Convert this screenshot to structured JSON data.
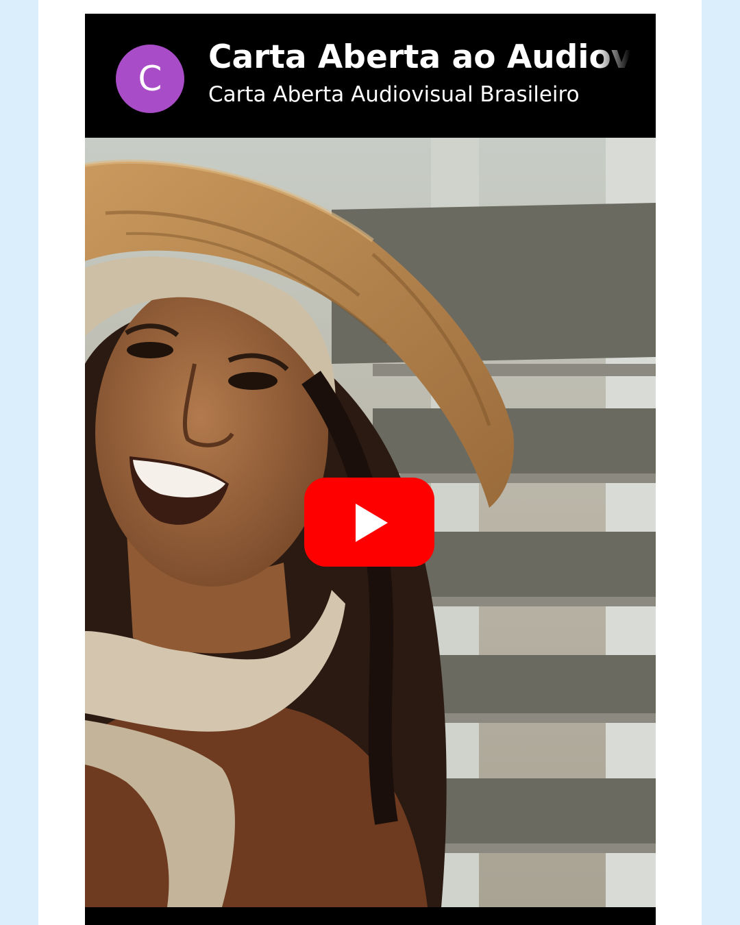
{
  "video": {
    "title": "Carta Aberta ao Audiovisual Brasileiro",
    "channel_name": "Carta Aberta Audiovisual Brasileiro",
    "avatar_letter": "C",
    "play_icon": "youtube-play-icon"
  },
  "colors": {
    "page_background": "#daeefc",
    "card_background": "#ffffff",
    "header_background": "#000000",
    "avatar_background": "#a94cc8",
    "play_button_red": "#ff0000",
    "text": "#ffffff"
  }
}
